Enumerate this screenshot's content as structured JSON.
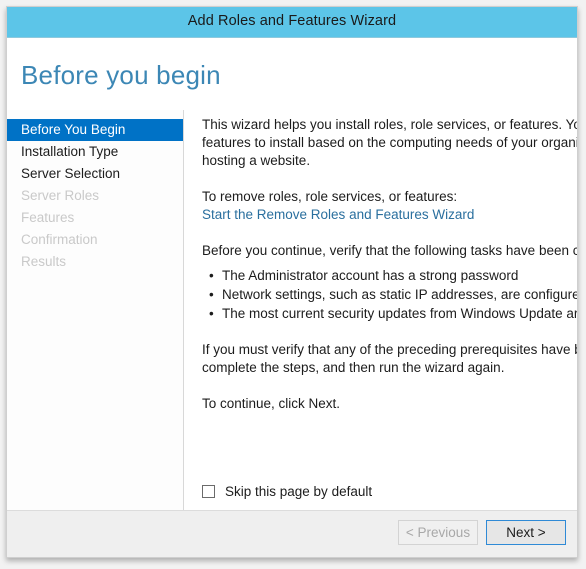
{
  "window": {
    "title": "Add Roles and Features Wizard"
  },
  "page": {
    "heading": "Before you begin"
  },
  "sidebar": {
    "items": [
      {
        "label": "Before You Begin",
        "state": "selected"
      },
      {
        "label": "Installation Type",
        "state": "enabled"
      },
      {
        "label": "Server Selection",
        "state": "enabled"
      },
      {
        "label": "Server Roles",
        "state": "disabled"
      },
      {
        "label": "Features",
        "state": "disabled"
      },
      {
        "label": "Confirmation",
        "state": "disabled"
      },
      {
        "label": "Results",
        "state": "disabled"
      }
    ]
  },
  "content": {
    "intro_line1": "This wizard helps you install roles, role services, or features. You determ",
    "intro_line2": "features to install based on the computing needs of your organization,",
    "intro_line3": "hosting a website.",
    "remove_prompt": "To remove roles, role services, or features:",
    "remove_link": "Start the Remove Roles and Features Wizard",
    "verify_prompt": "Before you continue, verify that the following tasks have been complet",
    "bullets": [
      "The Administrator account has a strong password",
      "Network settings, such as static IP addresses, are configured",
      "The most current security updates from Windows Update are installe"
    ],
    "prereq_line1": "If you must verify that any of the preceding prerequisites have been cc",
    "prereq_line2": "complete the steps, and then run the wizard again.",
    "continue_line": "To continue, click Next."
  },
  "skip": {
    "label": "Skip this page by default",
    "checked": false
  },
  "footer": {
    "previous_label": "< Previous",
    "next_label": "Next >"
  },
  "colors": {
    "title_bar": "#5cc5e8",
    "accent_selected": "#0072c6",
    "heading": "#3c87b5",
    "link": "#2a6f9e",
    "footer_bg": "#efefef",
    "default_button_border": "#2f8ad6"
  }
}
